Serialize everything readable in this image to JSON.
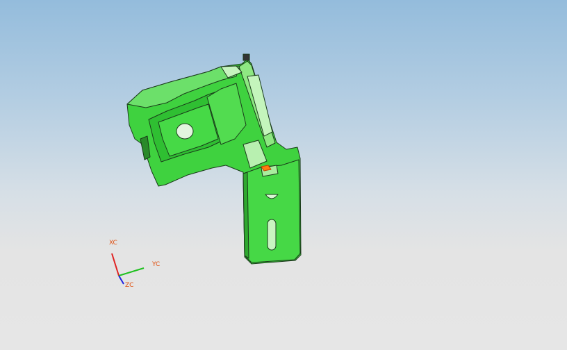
{
  "viewport": {
    "model": "green-bracket-part",
    "background_top": "#94bcdc",
    "background_bottom": "#e6e6e6",
    "part_color": "#3dd43d",
    "part_highlight": "#b8f2b0",
    "edge_color": "#1a3a1a"
  },
  "triad": {
    "xc_label": "XC",
    "yc_label": "YC",
    "zc_label": "ZC",
    "x_color": "#e02020",
    "y_color": "#20c020",
    "z_color": "#2020e0",
    "label_color": "#e05010"
  }
}
